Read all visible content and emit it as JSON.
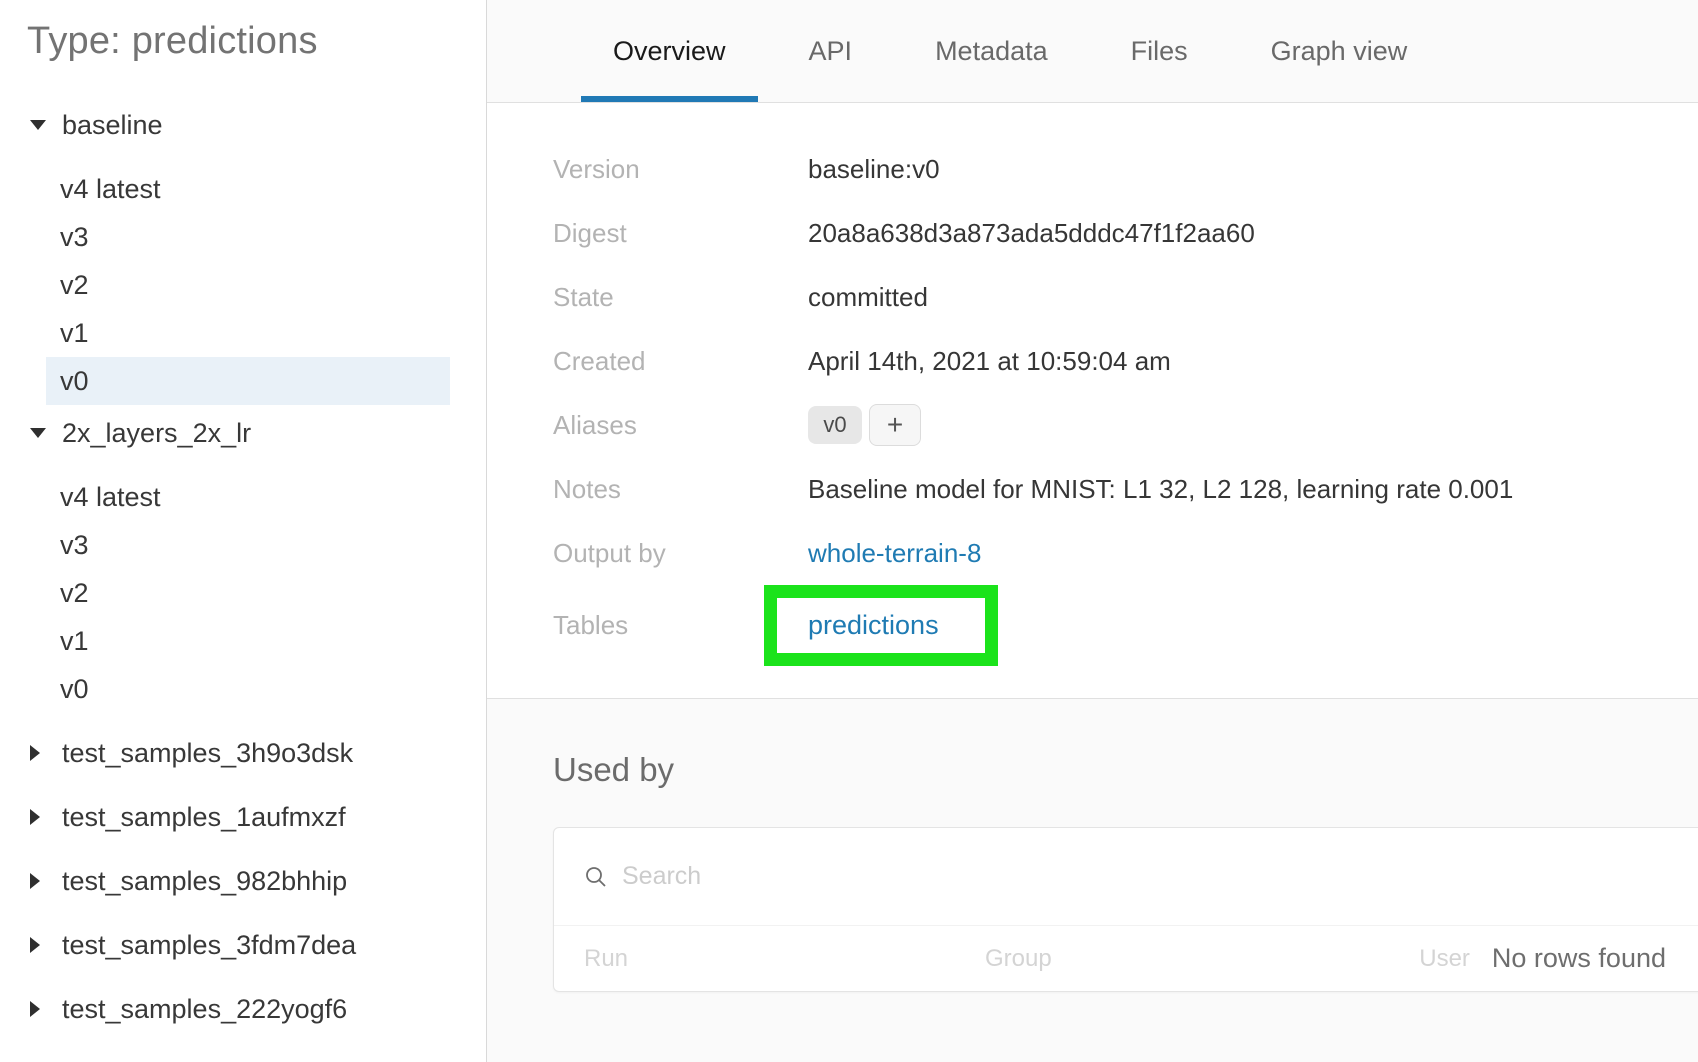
{
  "sidebar": {
    "title": "Type: predictions",
    "tree": [
      {
        "label": "baseline",
        "state": "expanded",
        "children": [
          {
            "label": "v4 latest",
            "selected": false
          },
          {
            "label": "v3",
            "selected": false
          },
          {
            "label": "v2",
            "selected": false
          },
          {
            "label": "v1",
            "selected": false
          },
          {
            "label": "v0",
            "selected": true
          }
        ]
      },
      {
        "label": "2x_layers_2x_lr",
        "state": "expanded",
        "children": [
          {
            "label": "v4 latest",
            "selected": false
          },
          {
            "label": "v3",
            "selected": false
          },
          {
            "label": "v2",
            "selected": false
          },
          {
            "label": "v1",
            "selected": false
          },
          {
            "label": "v0",
            "selected": false
          }
        ]
      },
      {
        "label": "test_samples_3h9o3dsk",
        "state": "collapsed"
      },
      {
        "label": "test_samples_1aufmxzf",
        "state": "collapsed"
      },
      {
        "label": "test_samples_982bhhip",
        "state": "collapsed"
      },
      {
        "label": "test_samples_3fdm7dea",
        "state": "collapsed"
      },
      {
        "label": "test_samples_222yogf6",
        "state": "collapsed"
      }
    ]
  },
  "tabs": {
    "items": [
      {
        "label": "Overview",
        "active": true
      },
      {
        "label": "API",
        "active": false
      },
      {
        "label": "Metadata",
        "active": false
      },
      {
        "label": "Files",
        "active": false
      },
      {
        "label": "Graph view",
        "active": false
      }
    ]
  },
  "overview": {
    "rows": [
      {
        "label": "Version",
        "value": "baseline:v0"
      },
      {
        "label": "Digest",
        "value": "20a8a638d3a873ada5dddc47f1f2aa60"
      },
      {
        "label": "State",
        "value": "committed"
      },
      {
        "label": "Created",
        "value": "April 14th, 2021 at 10:59:04 am"
      }
    ],
    "aliases": {
      "label": "Aliases",
      "badge": "v0",
      "add_label": "+"
    },
    "notes": {
      "label": "Notes",
      "value": "Baseline model for MNIST: L1 32, L2 128, learning rate 0.001"
    },
    "output_by": {
      "label": "Output by",
      "link": "whole-terrain-8"
    },
    "tables": {
      "label": "Tables",
      "link": "predictions"
    }
  },
  "used_by": {
    "title": "Used by",
    "search_placeholder": "Search",
    "columns": {
      "run": "Run",
      "group": "Group",
      "user": "User"
    },
    "empty_message": "No rows found"
  },
  "colors": {
    "link_blue": "#1f7bb3",
    "tab_underline_blue": "#2079b5",
    "annotation_green": "#1be31b",
    "selected_row_bg": "#e9f1f8"
  }
}
